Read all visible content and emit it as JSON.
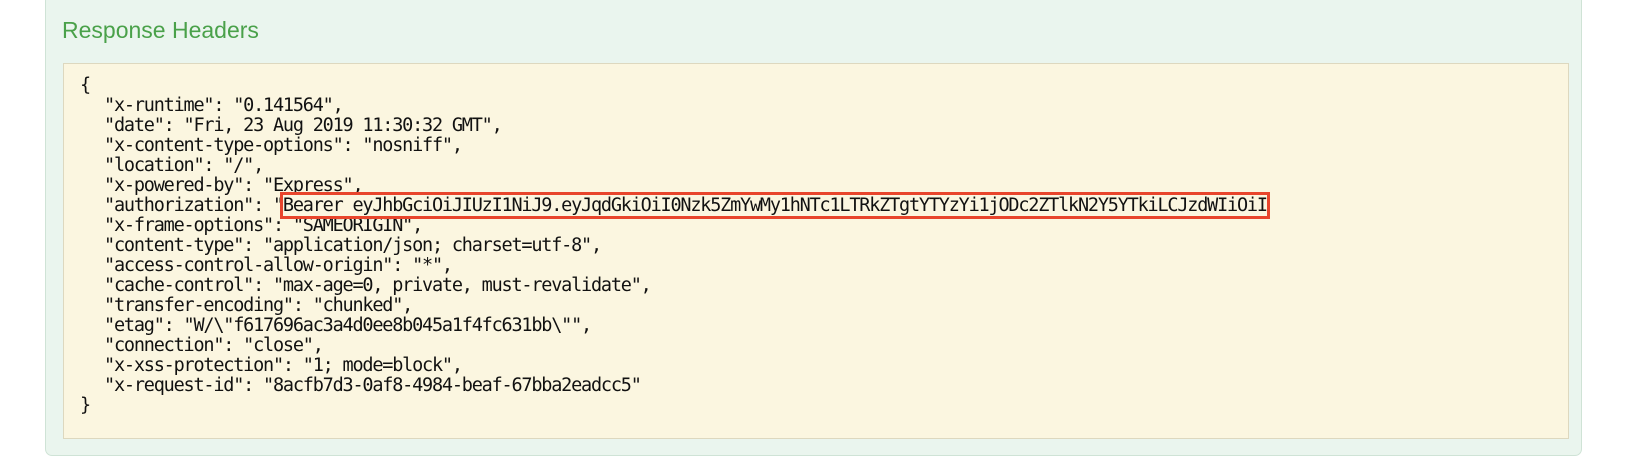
{
  "section": {
    "title": "Response Headers"
  },
  "colors": {
    "title": "#4aa14a",
    "panel_background": "#eaf5ee",
    "code_background": "#fbf6e0",
    "highlight_border": "#e8452c"
  },
  "response_headers": {
    "open_brace": "{",
    "close_brace": "}",
    "lines": [
      {
        "key_text": "\"x-runtime\": ",
        "value_text": "\"0.141564\","
      },
      {
        "key_text": "\"date\": ",
        "value_text": "\"Fri, 23 Aug 2019 11:30:32 GMT\","
      },
      {
        "key_text": "\"x-content-type-options\": ",
        "value_text": "\"nosniff\","
      },
      {
        "key_text": "\"location\": ",
        "value_text": "\"/\","
      },
      {
        "key_text": "\"x-powered-by\": ",
        "value_text": "\"Express\","
      },
      {
        "key_text": "\"authorization\": ",
        "value_prefix": "\"",
        "highlighted_value": "Bearer eyJhbGciOiJIUzI1NiJ9.eyJqdGkiOiI0Nzk5ZmYwMy1hNTc1LTRkZTgtYTYzYi1jODc2ZTlkN2Y5YTkiLCJzdWIiOiI"
      },
      {
        "key_text": "\"x-frame-options\": ",
        "value_text": "\"SAMEORIGIN\","
      },
      {
        "key_text": "\"content-type\": ",
        "value_text": "\"application/json; charset=utf-8\","
      },
      {
        "key_text": "\"access-control-allow-origin\": ",
        "value_text": "\"*\","
      },
      {
        "key_text": "\"cache-control\": ",
        "value_text": "\"max-age=0, private, must-revalidate\","
      },
      {
        "key_text": "\"transfer-encoding\": ",
        "value_text": "\"chunked\","
      },
      {
        "key_text": "\"etag\": ",
        "value_text": "\"W/\\\"f617696ac3a4d0ee8b045a1f4fc631bb\\\"\","
      },
      {
        "key_text": "\"connection\": ",
        "value_text": "\"close\","
      },
      {
        "key_text": "\"x-xss-protection\": ",
        "value_text": "\"1; mode=block\","
      },
      {
        "key_text": "\"x-request-id\": ",
        "value_text": "\"8acfb7d3-0af8-4984-beaf-67bba2eadcc5\""
      }
    ]
  }
}
